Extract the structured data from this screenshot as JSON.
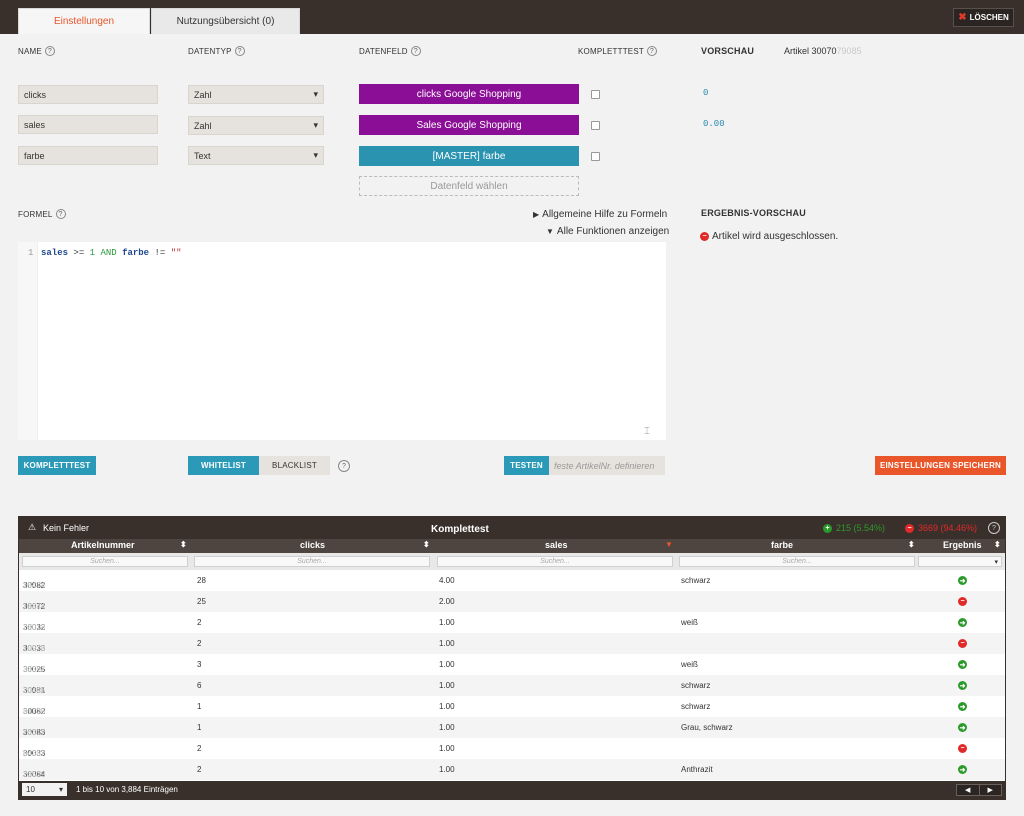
{
  "tabs": {
    "settings": "Einstellungen",
    "usage": "Nutzungsübersicht (0)"
  },
  "delete_label": "LÖSCHEN",
  "headers": {
    "name": "NAME",
    "type": "DATENTYP",
    "field": "DATENFELD",
    "fulltest": "KOMPLETTTEST",
    "preview": "VORSCHAU",
    "article_prefix": "Artikel 30070",
    "article_blur": "79085"
  },
  "rows": [
    {
      "name": "clicks",
      "type": "Zahl",
      "field": "clicks Google Shopping",
      "field_color": "#8b0f96",
      "preview": "0"
    },
    {
      "name": "sales",
      "type": "Zahl",
      "field": "Sales Google Shopping",
      "field_color": "#8b0f96",
      "preview": "0.00"
    },
    {
      "name": "farbe",
      "type": "Text",
      "field": "[MASTER] farbe",
      "field_color": "#2a93b0",
      "preview": ""
    }
  ],
  "select_field_label": "Datenfeld wählen",
  "formula": {
    "label": "FORMEL",
    "help_link": "Allgemeine Hilfe zu Formeln",
    "functions_link": "Alle Funktionen anzeigen",
    "line_number": "1",
    "code_ident1": "sales",
    "code_op1": ">=",
    "code_num": "1",
    "code_kw": "AND",
    "code_ident2": "farbe",
    "code_op2": "!=",
    "code_str": "\"\""
  },
  "result": {
    "title": "ERGEBNIS-VORSCHAU",
    "message": "Artikel wird ausgeschlossen."
  },
  "buttons": {
    "fulltest": "KOMPLETTTEST",
    "whitelist": "WHITELIST",
    "blacklist": "BLACKLIST",
    "test": "TESTEN",
    "test_placeholder": "feste ArtikelNr. definieren",
    "save": "EINSTELLUNGEN SPEICHERN"
  },
  "colors": {
    "accent": "#e8562a",
    "teal": "#2a9ab8",
    "purple": "#8b0f96",
    "dark": "#3a302b"
  },
  "table": {
    "status": "Kein Fehler",
    "title": "Komplettest",
    "ok_count": "215 (5.54%)",
    "no_count": "3669 (94.46%)",
    "columns": [
      "Artikelnummer",
      "clicks",
      "sales",
      "farbe",
      "Ergebnis"
    ],
    "search_placeholder": "Suchen...",
    "rows": [
      {
        "id": "30082",
        "id_blur": "15474",
        "clicks": "28",
        "sales": "4.00",
        "farbe": "schwarz",
        "result": "ok"
      },
      {
        "id": "30072",
        "id_blur": "18844",
        "clicks": "25",
        "sales": "2.00",
        "farbe": "",
        "result": "no"
      },
      {
        "id": "30032",
        "id_blur": "28018",
        "clicks": "2",
        "sales": "1.00",
        "farbe": "weiß",
        "result": "ok"
      },
      {
        "id": "30033",
        "id_blur": "10978",
        "clicks": "2",
        "sales": "1.00",
        "farbe": "",
        "result": "no"
      },
      {
        "id": "30025",
        "id_blur": "38367",
        "clicks": "3",
        "sales": "1.00",
        "farbe": "weiß",
        "result": "ok"
      },
      {
        "id": "30081",
        "id_blur": "20465",
        "clicks": "6",
        "sales": "1.00",
        "farbe": "schwarz",
        "result": "ok"
      },
      {
        "id": "30082",
        "id_blur": "81725",
        "clicks": "1",
        "sales": "1.00",
        "farbe": "schwarz",
        "result": "ok"
      },
      {
        "id": "30083",
        "id_blur": "76317",
        "clicks": "1",
        "sales": "1.00",
        "farbe": "Grau, schwarz",
        "result": "ok"
      },
      {
        "id": "30033",
        "id_blur": "64357",
        "clicks": "2",
        "sales": "1.00",
        "farbe": "",
        "result": "no"
      },
      {
        "id": "30084",
        "id_blur": "23529",
        "clicks": "2",
        "sales": "1.00",
        "farbe": "Anthrazit",
        "result": "ok"
      }
    ],
    "page_size": "10",
    "info": "1 bis 10 von 3,884 Einträgen"
  }
}
